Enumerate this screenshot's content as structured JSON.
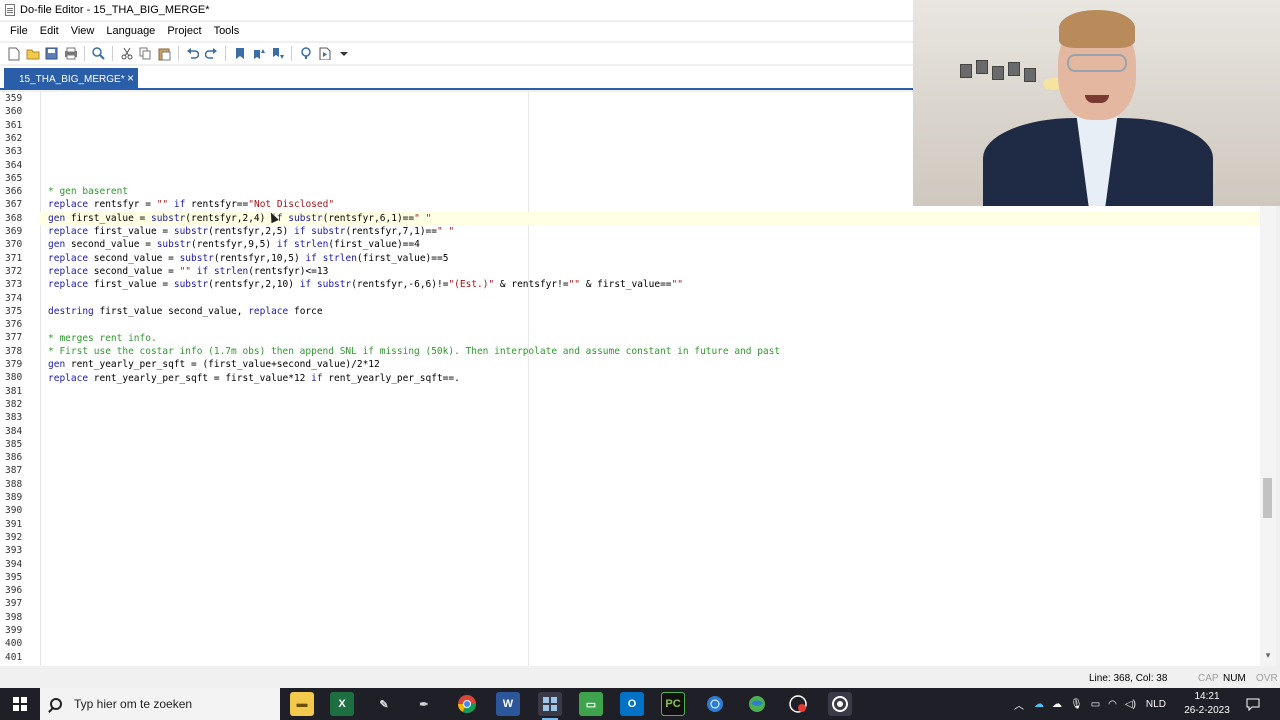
{
  "window": {
    "title": "Do-file Editor - 15_THA_BIG_MERGE*"
  },
  "menu": [
    "File",
    "Edit",
    "View",
    "Language",
    "Project",
    "Tools"
  ],
  "tab": {
    "label": "15_THA_BIG_MERGE*",
    "close": "×"
  },
  "editor": {
    "line_numbers": [
      "359",
      "360",
      "361",
      "362",
      "363",
      "364",
      "365",
      "366",
      "367",
      "368",
      "369",
      "370",
      "371",
      "372",
      "373",
      "374",
      "375",
      "376",
      "377",
      "378",
      "379",
      "380",
      "381",
      "382",
      "383",
      "384",
      "385",
      "386",
      "387",
      "388",
      "389",
      "390",
      "391",
      "392",
      "393",
      "394",
      "395",
      "396",
      "397",
      "398",
      "399",
      "400",
      "401"
    ],
    "lines": {
      "l366": "* gen baserent",
      "l367": "replace rentsfyr = \"\" if rentsfyr==\"Not Disclosed\"",
      "l368": "gen first_value = substr(rentsfyr,2,4) if substr(rentsfyr,6,1)==\" \"",
      "l369": "replace first_value = substr(rentsfyr,2,5) if substr(rentsfyr,7,1)==\" \"",
      "l370": "gen second_value = substr(rentsfyr,9,5) if strlen(first_value)==4",
      "l371": "replace second_value = substr(rentsfyr,10,5) if strlen(first_value)==5",
      "l372": "replace second_value = \"\" if strlen(rentsfyr)<=13",
      "l373": "replace first_value = substr(rentsfyr,2,10) if substr(rentsfyr,-6,6)!=\"(Est.)\" & rentsfyr!=\"\" & first_value==\"\"",
      "l375": "destring first_value second_value, replace force",
      "l377": "* merges rent info.",
      "l378": "* First use the costar info (1.7m obs) then append SNL if missing (50k). Then interpolate and assume constant in future and past",
      "l379": "gen rent_yearly_per_sqft = (first_value+second_value)/2*12",
      "l380": "replace rent_yearly_per_sqft = first_value*12 if rent_yearly_per_sqft==."
    }
  },
  "status": {
    "position": "Line: 368, Col: 38",
    "cap": "CAP",
    "num": "NUM",
    "ovr": "OVR"
  },
  "taskbar": {
    "search_placeholder": "Typ hier om te zoeken",
    "language": "NLD",
    "time": "14:21",
    "date": "26-2-2023"
  },
  "colors": {
    "accent": "#2a5ea8",
    "comment": "#2f9a2f",
    "current_line": "#ffffe3"
  }
}
